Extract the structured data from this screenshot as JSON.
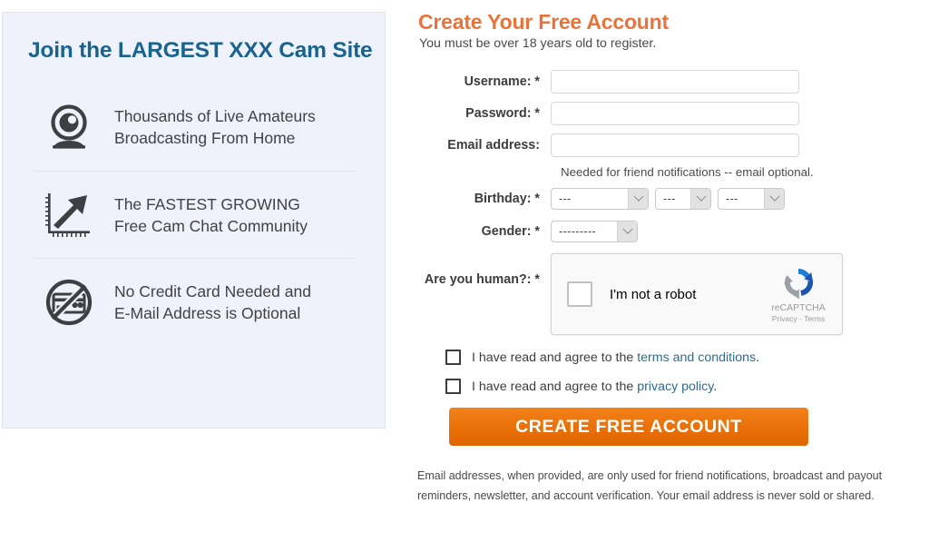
{
  "promo": {
    "title": "Join the LARGEST XXX Cam Site",
    "items": [
      {
        "icon": "webcam-icon",
        "line1": "Thousands of Live Amateurs",
        "line2": "Broadcasting From Home"
      },
      {
        "icon": "growth-chart-icon",
        "line1": "The FASTEST GROWING",
        "line2": "Free Cam Chat Community"
      },
      {
        "icon": "no-credit-card-icon",
        "line1": "No Credit Card Needed and",
        "line2": "E-Mail Address is Optional"
      }
    ],
    "accent_color": "#19648f",
    "panel_background": "#eff2fa"
  },
  "form": {
    "title": "Create Your Free Account",
    "subtitle": "You must be over 18 years old to register.",
    "title_color": "#e8743b",
    "fields": {
      "username": {
        "label": "Username: *",
        "value": "",
        "placeholder": ""
      },
      "password": {
        "label": "Password: *",
        "value": "",
        "placeholder": ""
      },
      "email": {
        "label": "Email address:",
        "value": "",
        "placeholder": "",
        "hint": "Needed for friend notifications -- email optional."
      },
      "birthday": {
        "label": "Birthday: *",
        "year": "---",
        "month": "---",
        "day": "---"
      },
      "gender": {
        "label": "Gender: *",
        "value": "---------"
      },
      "human": {
        "label": "Are you human?: *"
      }
    },
    "recaptcha": {
      "checkbox_label": "I'm not a robot",
      "brand": "reCAPTCHA",
      "links": "Privacy - Terms"
    },
    "agreements": [
      {
        "prefix": "I have read and agree to the ",
        "link": "terms and conditions",
        "suffix": "."
      },
      {
        "prefix": "I have read and agree to the ",
        "link": "privacy policy",
        "suffix": "."
      }
    ],
    "submit_label": "CREATE FREE ACCOUNT",
    "submit_color": "#ea7008",
    "footnote": "Email addresses, when provided, are only used for friend notifications, broadcast and payout reminders, newsletter, and account verification. Your email address is never sold or shared."
  }
}
